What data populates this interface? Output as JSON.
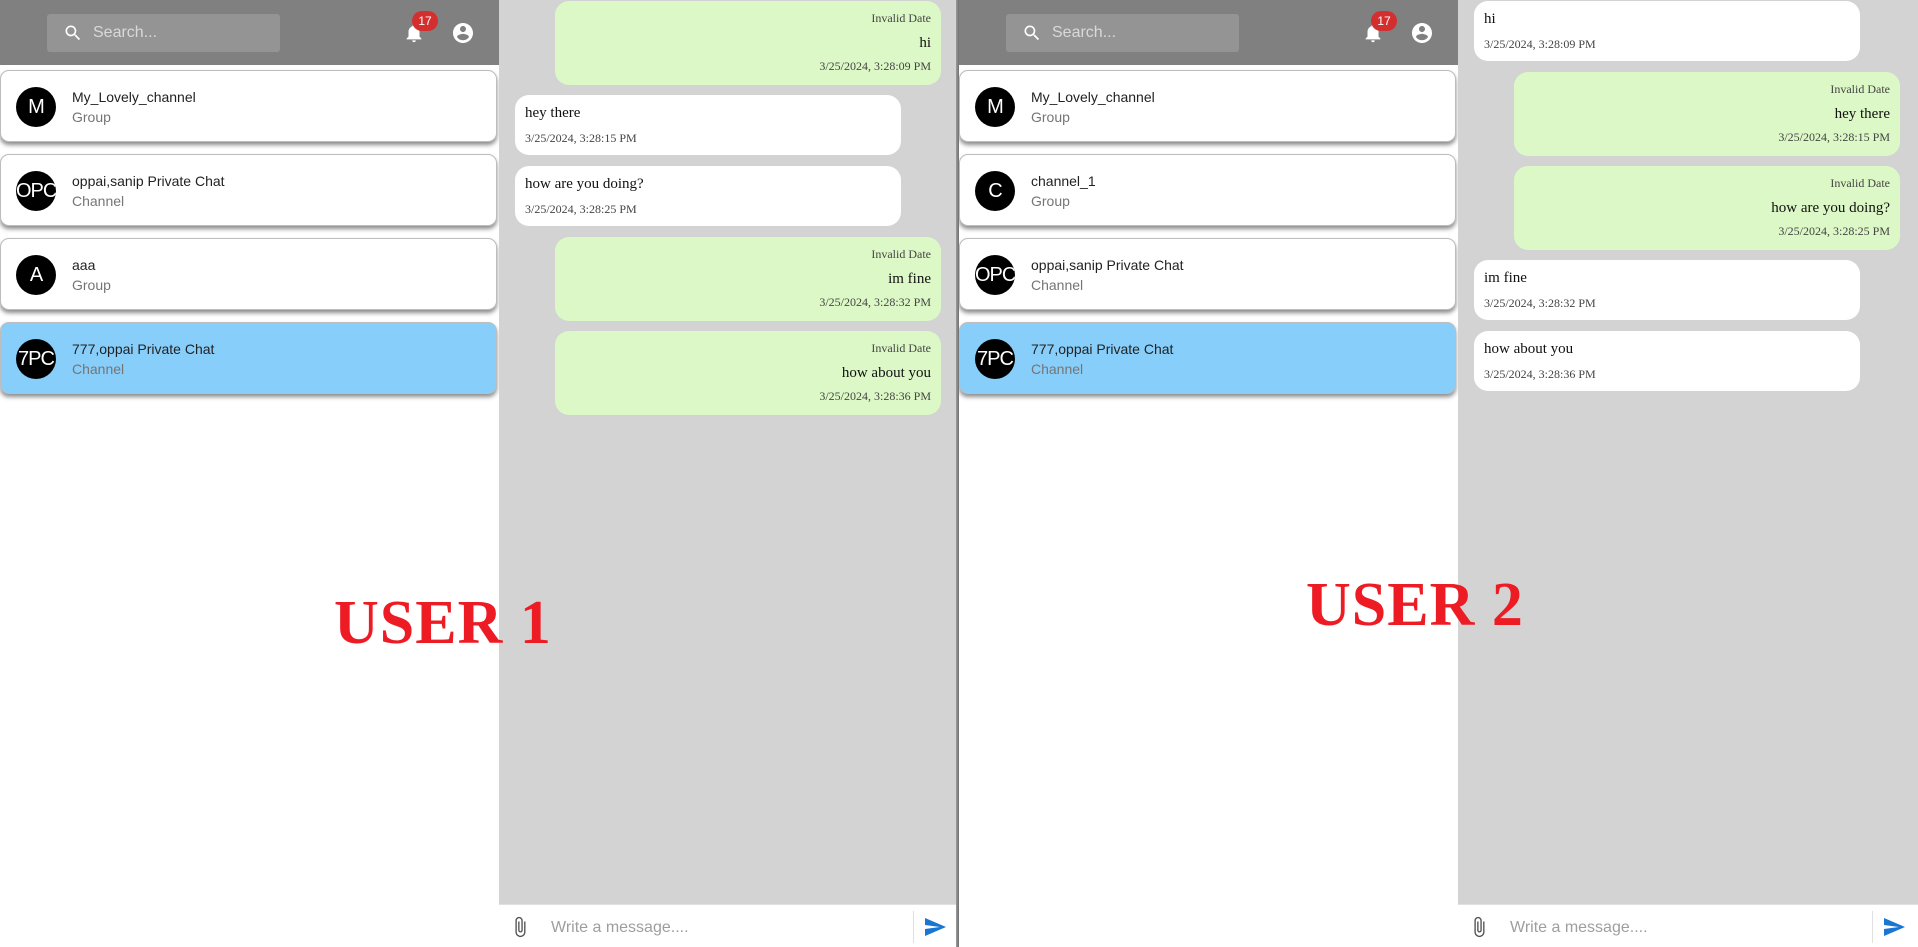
{
  "colors": {
    "topbar": "#808080",
    "search_bg": "#949494",
    "badge": "#d32f2f",
    "active_chat": "#87cefa",
    "sent_bubble": "#dcf8c6",
    "received_bubble": "#ffffff",
    "message_area": "#d3d3d3",
    "send_icon": "#1976d2",
    "label": "#ed1c24"
  },
  "labels": {
    "user1": "USER 1",
    "user2": "USER 2"
  },
  "screen1": {
    "search": {
      "placeholder": "Search..."
    },
    "notifications": {
      "count": "17",
      "icon": "bell-icon"
    },
    "account_icon": "account-circle-icon",
    "chats": [
      {
        "avatar": "M",
        "name": "My_Lovely_channel",
        "type": "Group"
      },
      {
        "avatar": "OPC",
        "name": "oppai,sanip Private Chat",
        "type": "Channel"
      },
      {
        "avatar": "A",
        "name": "aaa",
        "type": "Group"
      },
      {
        "avatar": "7PC",
        "name": "777,oppai Private Chat",
        "type": "Channel",
        "active": true
      }
    ],
    "messages": [
      {
        "direction": "sent",
        "date": "Invalid Date",
        "text": "hi",
        "time": "3/25/2024, 3:28:09 PM"
      },
      {
        "direction": "received",
        "text": "hey there",
        "time": "3/25/2024, 3:28:15 PM"
      },
      {
        "direction": "received",
        "text": "how are you doing?",
        "time": "3/25/2024, 3:28:25 PM"
      },
      {
        "direction": "sent",
        "date": "Invalid Date",
        "text": "im fine",
        "time": "3/25/2024, 3:28:32 PM"
      },
      {
        "direction": "sent",
        "date": "Invalid Date",
        "text": "how about you",
        "time": "3/25/2024, 3:28:36 PM"
      }
    ],
    "composer": {
      "placeholder": "Write a message....",
      "attach_icon": "paperclip-icon",
      "send_icon": "send-icon"
    }
  },
  "screen2": {
    "search": {
      "placeholder": "Search..."
    },
    "notifications": {
      "count": "17",
      "icon": "bell-icon"
    },
    "account_icon": "account-circle-icon",
    "chats": [
      {
        "avatar": "M",
        "name": "My_Lovely_channel",
        "type": "Group"
      },
      {
        "avatar": "C",
        "name": "channel_1",
        "type": "Group"
      },
      {
        "avatar": "OPC",
        "name": "oppai,sanip Private Chat",
        "type": "Channel"
      },
      {
        "avatar": "7PC",
        "name": "777,oppai Private Chat",
        "type": "Channel",
        "active": true
      }
    ],
    "messages": [
      {
        "direction": "received",
        "text": "hi",
        "time": "3/25/2024, 3:28:09 PM"
      },
      {
        "direction": "sent",
        "date": "Invalid Date",
        "text": "hey there",
        "time": "3/25/2024, 3:28:15 PM"
      },
      {
        "direction": "sent",
        "date": "Invalid Date",
        "text": "how are you doing?",
        "time": "3/25/2024, 3:28:25 PM"
      },
      {
        "direction": "received",
        "text": "im fine",
        "time": "3/25/2024, 3:28:32 PM"
      },
      {
        "direction": "received",
        "text": "how about you",
        "time": "3/25/2024, 3:28:36 PM"
      }
    ],
    "composer": {
      "placeholder": "Write a message....",
      "attach_icon": "paperclip-icon",
      "send_icon": "send-icon"
    }
  }
}
